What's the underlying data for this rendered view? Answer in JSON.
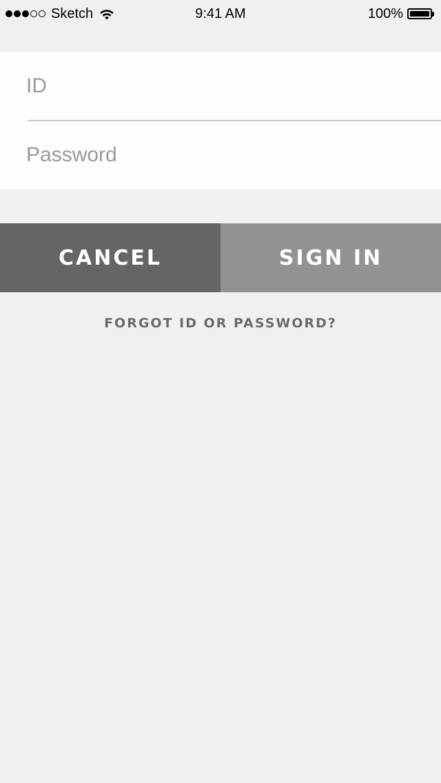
{
  "status_bar": {
    "carrier": "Sketch",
    "time": "9:41 AM",
    "battery": "100%",
    "signal_bars_filled": 3,
    "signal_bars_total": 5,
    "battery_level": 1.0
  },
  "login_form": {
    "id_field": {
      "value": "",
      "placeholder": "ID"
    },
    "password_field": {
      "value": "",
      "placeholder": "Password"
    }
  },
  "actions": {
    "cancel_label": "CANCEL",
    "signin_label": "SIGN IN",
    "forgot_label": "FORGOT ID OR PASSWORD?"
  },
  "colors": {
    "background": "#f0f0f0",
    "card": "#fdfdfd",
    "cancel_button": "#656565",
    "signin_button": "#929292",
    "forgot_text": "#6a6a6a",
    "placeholder_text": "#9a9a9a"
  },
  "icons": {
    "wifi": "wifi-icon",
    "battery": "battery-icon",
    "signal": "signal-strength-icon"
  }
}
